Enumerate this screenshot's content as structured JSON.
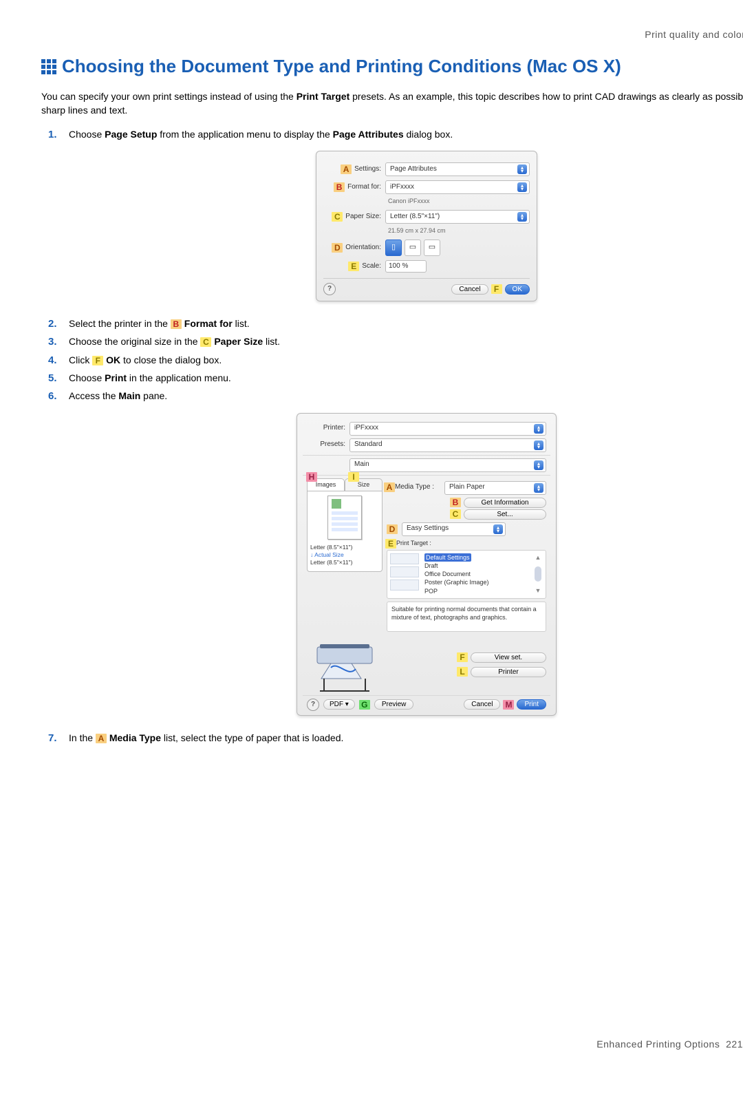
{
  "header": "Print quality and color settings",
  "title": "Choosing the Document Type and Printing Conditions (Mac OS X)",
  "intro_parts": [
    "You can specify your own print settings instead of using the ",
    "Print Target",
    " presets. As an example, this topic describes how to print CAD drawings as clearly as possible, with sharp lines and text."
  ],
  "steps": {
    "s1": {
      "pre": "Choose ",
      "b1": "Page Setup",
      "mid": " from the application menu to display the ",
      "b2": "Page Attributes",
      "post": " dialog box."
    },
    "s2": {
      "pre": "Select the printer in the ",
      "letter": "B",
      "b1": "Format for",
      "post": " list."
    },
    "s3": {
      "pre": "Choose the original size in the ",
      "letter": "C",
      "b1": "Paper Size",
      "post": " list."
    },
    "s4": {
      "pre": "Click ",
      "letter": "F",
      "b1": "OK",
      "post": " to close the dialog box."
    },
    "s5": {
      "pre": "Choose ",
      "b1": "Print",
      "post": " in the application menu."
    },
    "s6": {
      "pre": "Access the ",
      "b1": "Main",
      "post": " pane."
    },
    "s7": {
      "pre": "In the ",
      "letter": "A",
      "b1": "Media Type",
      "post": " list, select the type of paper that is loaded."
    }
  },
  "page_setup": {
    "labels": {
      "settings": "Settings:",
      "format_for": "Format for:",
      "paper_size": "Paper Size:",
      "orientation": "Orientation:",
      "scale": "Scale:"
    },
    "settings_value": "Page Attributes",
    "format_value": "iPFxxxx",
    "format_sub": "Canon iPFxxxx",
    "paper_value": "Letter (8.5\"×11\")",
    "paper_sub": "21.59 cm x 27.94 cm",
    "scale_value": "100 %",
    "cancel": "Cancel",
    "ok": "OK",
    "callouts": {
      "A": "A",
      "B": "B",
      "C": "C",
      "D": "D",
      "E": "E",
      "F": "F"
    }
  },
  "print_dialog": {
    "labels": {
      "printer": "Printer:",
      "presets": "Presets:"
    },
    "printer_value": "iPFxxxx",
    "presets_value": "Standard",
    "pane_value": "Main",
    "tabs": {
      "images": "Images",
      "size": "Size"
    },
    "size_info": {
      "line1": "Letter (8.5\"×11\")",
      "line2": "Actual Size",
      "line3": "Letter (8.5\"×11\")"
    },
    "media_type_label": "Media Type :",
    "media_type_value": "Plain Paper",
    "get_info": "Get Information",
    "set_btn": "Set...",
    "easy_settings": "Easy Settings",
    "print_target_label": "Print Target :",
    "targets": {
      "t0": "Default Settings",
      "t1": "Draft",
      "t2": "Office Document",
      "t3": "Poster (Graphic Image)",
      "t4": "POP"
    },
    "description": "Suitable for printing normal documents that contain a mixture of text, photographs and graphics.",
    "view_set": "View set.",
    "printer_btn": "Printer",
    "pdf": "PDF ▾",
    "preview": "Preview",
    "cancel": "Cancel",
    "print": "Print",
    "callouts": {
      "A": "A",
      "B": "B",
      "C": "C",
      "D": "D",
      "E": "E",
      "F": "F",
      "G": "G",
      "H": "H",
      "I": "I",
      "L": "L",
      "M": "M"
    }
  },
  "footer": {
    "label": "Enhanced Printing Options",
    "page": "221"
  }
}
